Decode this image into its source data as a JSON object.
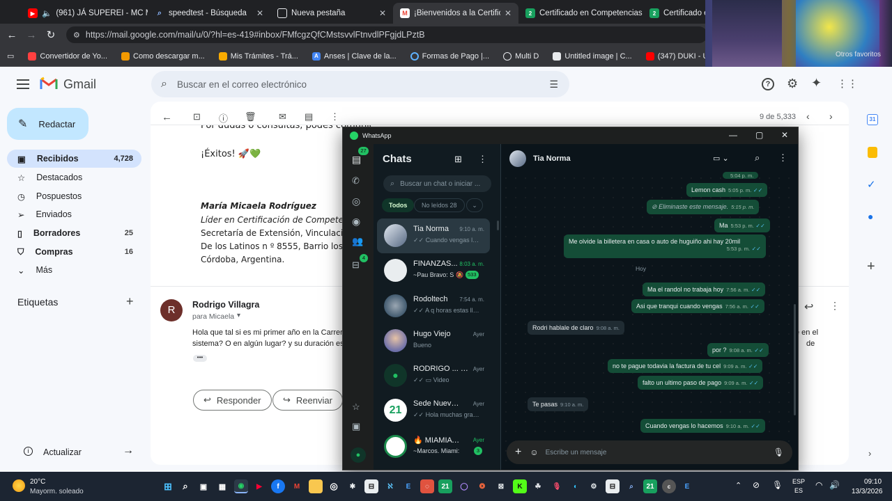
{
  "browser": {
    "tabs": [
      {
        "title": "(961) JÁ SUPEREI - MC M",
        "icon": "youtube-icon"
      },
      {
        "title": "speedtest - Búsqueda",
        "icon": "search-icon"
      },
      {
        "title": "Nueva pestaña",
        "icon": "newtab-icon"
      },
      {
        "title": "¡Bienvenidos a la Certificación",
        "icon": "gmail-icon"
      },
      {
        "title": "Certificado en Competencias",
        "icon": "cert-21-icon"
      },
      {
        "title": "Certificado en",
        "icon": "cert-21-icon"
      }
    ],
    "url": "https://mail.google.com/mail/u/0/?hl=es-419#inbox/FMfcgzQfCMstsvvlFtnvdlPFgjdLPztB",
    "bookmarks": [
      {
        "label": "Convertidor de Yo..."
      },
      {
        "label": "Como descargar m..."
      },
      {
        "label": "Mis Trámites - Trá..."
      },
      {
        "label": "Anses | Clave de la..."
      },
      {
        "label": "Formas de Pago |..."
      },
      {
        "label": "Multi D"
      },
      {
        "label": "Untitled image | C..."
      },
      {
        "label": "(347) DUKI - UH A..."
      }
    ],
    "other_favorites": "Otros favoritos"
  },
  "gmail": {
    "brand": "Gmail",
    "search_placeholder": "Buscar en el correo electrónico",
    "compose": "Redactar",
    "nav": [
      {
        "label": "Recibidos",
        "count": "4,728"
      },
      {
        "label": "Destacados",
        "count": ""
      },
      {
        "label": "Pospuestos",
        "count": ""
      },
      {
        "label": "Enviados",
        "count": ""
      },
      {
        "label": "Borradores",
        "count": "25"
      },
      {
        "label": "Compras",
        "count": "16"
      },
      {
        "label": "Más",
        "count": ""
      }
    ],
    "labels_title": "Etiquetas",
    "update": "Actualizar",
    "pagination": "9 de 5,333",
    "avatar_letter": "R",
    "email": {
      "line_cut": "Por dudas o consultas, podes comunic",
      "exitos": "¡Éxitos! 🚀💚",
      "sig_name": "María Micaela Rodríguez",
      "sig_role": "Líder en Certificación de Competencias",
      "sig_l1": "Secretaría de Extensión, Vinculación e",
      "sig_l2": "De los Latinos n º 8555, Barrio los Bou",
      "sig_l3": "Córdoba, Argentina."
    },
    "reply": {
      "sender": "Rodrigo Villagra",
      "avatar_letter": "R",
      "to": "para Micaela",
      "body1": "Hola que tal si es mi primer año en la Carrera",
      "body2": "sistema? O en algún lugar? y su duración es",
      "body_right1": "e en el",
      "body_right2": "de"
    },
    "buttons": {
      "reply": "Responder",
      "forward": "Reenviar"
    }
  },
  "whatsapp": {
    "app_title": "WhatsApp",
    "unread_badge": "27",
    "archive_badge": "4",
    "chats_title": "Chats",
    "search_placeholder": "Buscar un chat o iniciar ...",
    "filters": {
      "all": "Todos",
      "unread": "No leídos 28"
    },
    "chats": [
      {
        "name": "Tia Norma",
        "time": "9:10 a. m.",
        "msg": "Cuando vengas lo ...",
        "badge": ""
      },
      {
        "name": "FINANZAS...",
        "time": "8:03 a. m.",
        "msg": "~Pau Bravo: S",
        "badge": "533"
      },
      {
        "name": "Rodoltech",
        "time": "7:54 a. m.",
        "msg": "A q horas estas lle...",
        "badge": ""
      },
      {
        "name": "Hugo Viejo",
        "time": "Ayer",
        "msg": "Bueno",
        "badge": ""
      },
      {
        "name": "RODRIGO ... (Tú)",
        "time": "Ayer",
        "msg": "Video",
        "badge": ""
      },
      {
        "name": "Sede Nueva Co...",
        "time": "Ayer",
        "msg": "Hola muchas grac...",
        "badge": ""
      },
      {
        "name": "🔥 MIAMIAVE...",
        "time": "Ayer",
        "msg": "~Marcos. Miami:",
        "badge": "3"
      }
    ],
    "contact": "Tia Norma",
    "day_label": "Hoy",
    "messages": [
      {
        "dir": "out",
        "text": "",
        "time": "5:04 p. m."
      },
      {
        "dir": "out",
        "text": "Lemon cash",
        "time": "5:05 p. m."
      },
      {
        "dir": "out",
        "text": "Eliminaste este mensaje.",
        "time": "5:15 p. m."
      },
      {
        "dir": "out",
        "text": "Ma",
        "time": "5:53 p. m."
      },
      {
        "dir": "out",
        "text": "Me olvide la billetera en casa o auto de huguiño ahi hay 20mil",
        "time": "5:53 p. m."
      },
      {
        "dir": "out",
        "text": "Ma el randol no trabaja hoy",
        "time": "7:56 a. m."
      },
      {
        "dir": "out",
        "text": "Asi que tranqui cuando vengas",
        "time": "7:56 a. m."
      },
      {
        "dir": "in",
        "text": "Rodri hablale de claro",
        "time": "9:08 a. m."
      },
      {
        "dir": "out",
        "text": "por ?",
        "time": "9:08 a. m."
      },
      {
        "dir": "out",
        "text": "no te pague todavia la factura de tu cel",
        "time": "9:09 a. m."
      },
      {
        "dir": "out",
        "text": "falto un ultimo paso de pago",
        "time": "9:09 a. m."
      },
      {
        "dir": "in",
        "text": "Te pasas",
        "time": "9:10 a. m."
      },
      {
        "dir": "out",
        "text": "Cuando vengas lo hacemos",
        "time": "9:10 a. m."
      }
    ],
    "composer_placeholder": "Escribe un mensaje"
  },
  "taskbar": {
    "temp": "20°C",
    "weather": "Mayorm. soleado",
    "lang1": "ESP",
    "lang2": "ES",
    "time": "09:10",
    "date": "13/3/2026"
  }
}
